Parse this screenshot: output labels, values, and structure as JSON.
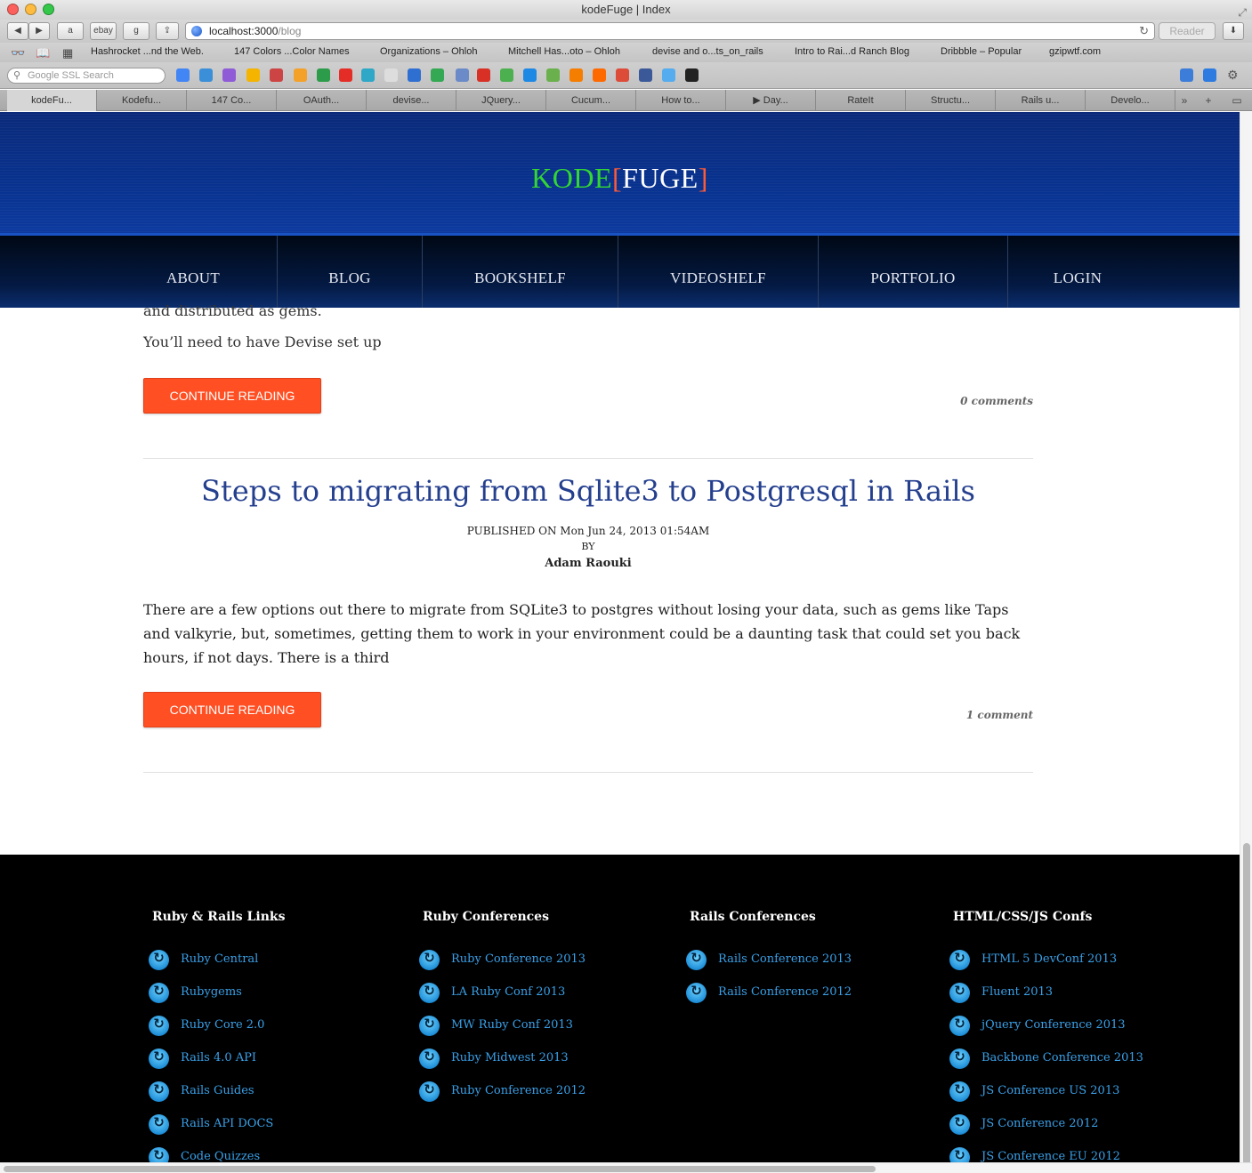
{
  "window": {
    "title": "kodeFuge | Index"
  },
  "toolbar": {
    "ebay_label": "ebay",
    "url_host": "localhost:3000",
    "url_path": "/blog",
    "reader_label": "Reader"
  },
  "bookmarks": [
    "Hashrocket ...nd the Web.",
    "147 Colors ...Color Names",
    "Organizations – Ohloh",
    "Mitchell Has...oto – Ohloh",
    "devise and o...ts_on_rails",
    "Intro to Rai...d Ranch Blog",
    "Dribbble – Popular",
    "gzipwtf.com"
  ],
  "search": {
    "placeholder": "Google SSL Search"
  },
  "tabs": [
    "kodeFu...",
    "Kodefu...",
    "147 Co...",
    "OAuth...",
    "devise...",
    "JQuery...",
    "Cucum...",
    "How to...",
    "▶ Day...",
    "RateIt",
    "Structu...",
    "Rails u...",
    "Develo..."
  ],
  "site": {
    "logo_kode": "KODE",
    "logo_open": "[",
    "logo_fuge": "FUGE",
    "logo_close": "]",
    "nav": [
      "ABOUT",
      "BLOG",
      "BOOKSHELF",
      "VIDEOSHELF",
      "PORTFOLIO",
      "LOGIN"
    ]
  },
  "post1": {
    "fragment_top": "and distributed as gems.",
    "fragment": "You’ll need to have Devise set up",
    "button": "CONTINUE READING",
    "comments": "0 comments"
  },
  "post2": {
    "title": "Steps to migrating from Sqlite3 to Postgresql in Rails",
    "published": "PUBLISHED ON Mon Jun 24, 2013 01:54AM",
    "by": "BY",
    "author": "Adam Raouki",
    "excerpt": "There are a few options out there to migrate from SQLite3 to postgres without losing your data, such as gems like Taps and valkyrie, but, sometimes, getting them to work in your environment could be a daunting task that could set you back hours, if not days. There is a third",
    "button": "CONTINUE READING",
    "comments": "1 comment"
  },
  "footer": {
    "columns": [
      {
        "heading": "Ruby & Rails Links",
        "links": [
          "Ruby Central",
          "Rubygems",
          "Ruby Core 2.0",
          "Rails 4.0 API",
          "Rails Guides",
          "Rails API DOCS",
          "Code Quizzes"
        ]
      },
      {
        "heading": "Ruby Conferences",
        "links": [
          "Ruby Conference 2013",
          "LA Ruby Conf 2013",
          "MW Ruby Conf 2013",
          "Ruby Midwest 2013",
          "Ruby Conference 2012"
        ]
      },
      {
        "heading": "Rails Conferences",
        "links": [
          "Rails Conference 2013",
          "Rails Conference 2012"
        ]
      },
      {
        "heading": "HTML/CSS/JS Confs",
        "links": [
          "HTML 5 DevConf 2013",
          "Fluent 2013",
          "jQuery Conference 2013",
          "Backbone Conference 2013",
          "JS Conference US 2013",
          "JS Conference 2012",
          "JS Conference EU 2012"
        ]
      }
    ]
  },
  "colors": {
    "accent": "#ff4f23",
    "link": "#3aa0e8",
    "title": "#243f8e",
    "header_bg": "#08328f"
  }
}
